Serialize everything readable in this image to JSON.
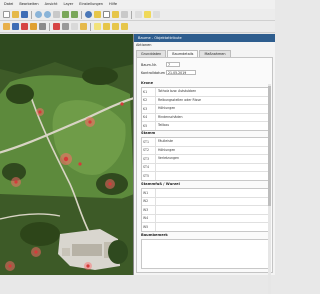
{
  "menubar": [
    "Datei",
    "Bearbeiten",
    "Ansicht",
    "Layer",
    "Einstellungen",
    "Hilfe"
  ],
  "panel": {
    "title": "Baume - Objektattribute",
    "status": "Aktionen",
    "tabs": [
      "Grunddaten",
      "Baumdetails",
      "Maßnahmen"
    ],
    "active_tab": 1,
    "fields": {
      "baum_nr_label": "Baum-Nr.",
      "baum_nr_value": "7",
      "kontrolldatum_label": "Kontrolldatum",
      "kontrolldatum_value": "21.05.2019"
    },
    "sections": [
      {
        "title": "Krone",
        "rows": [
          {
            "code": "K1",
            "text": "Totholz bzw. Aststubben"
          },
          {
            "code": "K2",
            "text": "Reibungsstellen oder Risse"
          },
          {
            "code": "K3",
            "text": "Höhlungen"
          },
          {
            "code": "K4",
            "text": "Rindenschäden"
          },
          {
            "code": "K5",
            "text": "Teilbau"
          }
        ]
      },
      {
        "title": "Stamm",
        "rows": [
          {
            "code": "ST1",
            "text": "Fäulleiste"
          },
          {
            "code": "ST2",
            "text": "Höhlungen"
          },
          {
            "code": "ST3",
            "text": "Verletzungen"
          },
          {
            "code": "ST4",
            "text": ""
          },
          {
            "code": "ST5",
            "text": ""
          }
        ]
      },
      {
        "title": "Stammfuß / Wurzel",
        "rows": [
          {
            "code": "W1",
            "text": ""
          },
          {
            "code": "W2",
            "text": ""
          },
          {
            "code": "W3",
            "text": ""
          },
          {
            "code": "W4",
            "text": ""
          },
          {
            "code": "W5",
            "text": ""
          }
        ]
      },
      {
        "title": "Baumbemerk",
        "rows": []
      }
    ]
  },
  "colors": {
    "title_bar": "#2e5d8e",
    "marker": "#d63a3a",
    "lawn": "#5d8a3c",
    "forest": "#2f4a1f",
    "path": "#d8d4c4"
  }
}
